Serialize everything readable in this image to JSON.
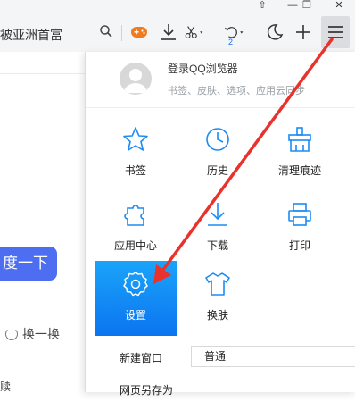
{
  "toolbar": {
    "address_text": "被亚洲首富",
    "icons": [
      "pin-icon",
      "minimize-icon",
      "restore-icon",
      "close-icon",
      "search-icon",
      "game-icon",
      "download-icon",
      "scissors-icon",
      "undo-icon",
      "moon-icon",
      "plus-icon",
      "menu-icon"
    ],
    "undo_badge": "2"
  },
  "page": {
    "button_text": "度一下",
    "refresh_text": "换一换",
    "fragment_text": "赎"
  },
  "menu": {
    "login_title": "登录QQ浏览器",
    "login_subtitle": "书签、皮肤、选项、应用云同步",
    "grid": [
      {
        "label": "书签",
        "icon": "star-icon"
      },
      {
        "label": "历史",
        "icon": "clock-icon"
      },
      {
        "label": "清理痕迹",
        "icon": "broom-icon"
      },
      {
        "label": "应用中心",
        "icon": "puzzle-icon"
      },
      {
        "label": "下载",
        "icon": "download-icon"
      },
      {
        "label": "打印",
        "icon": "printer-icon"
      },
      {
        "label": "设置",
        "icon": "gear-icon",
        "active": true
      },
      {
        "label": "换肤",
        "icon": "shirt-icon"
      }
    ],
    "new_window_label": "新建窗口",
    "new_window_value": "普通",
    "save_as_label": "网页另存为"
  },
  "colors": {
    "accent": "#1890f5",
    "annotation_arrow": "#e8322b",
    "page_button": "#4e6ef2"
  }
}
